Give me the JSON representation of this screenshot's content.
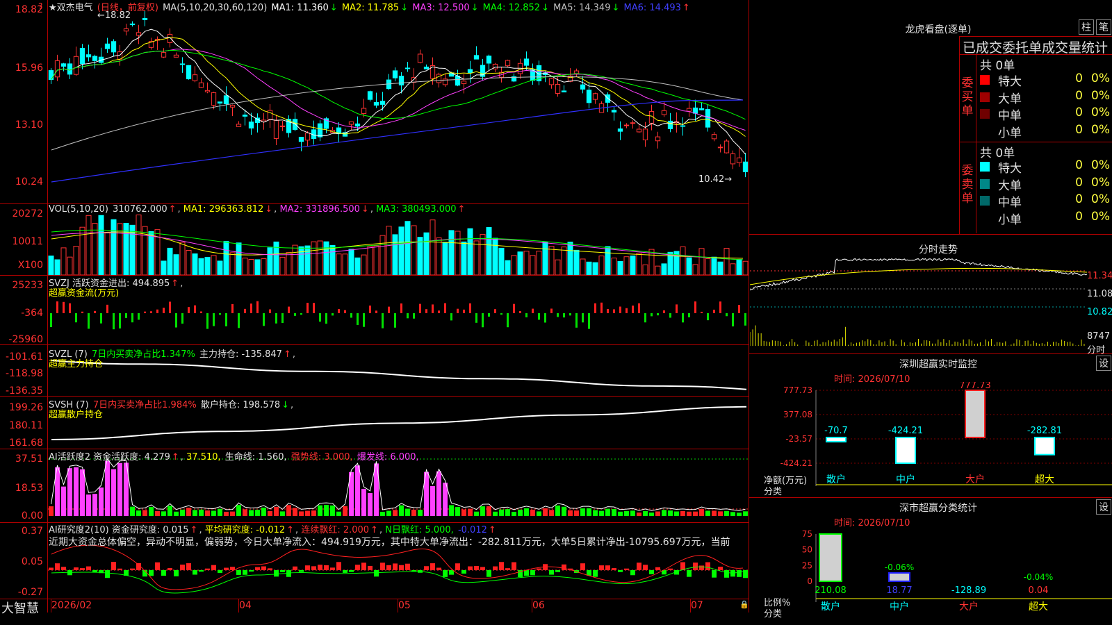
{
  "app": {
    "name": "大智慧"
  },
  "stock": {
    "name": "★双杰电气",
    "period": "(日线，前复权)"
  },
  "ma_legend": {
    "prefix": "MA(5,10,20,30,60,120)",
    "items": [
      {
        "label": "MA1: 11.360",
        "arrow": "↓",
        "color": "#ffffff"
      },
      {
        "label": "MA2: 11.785",
        "arrow": "↓",
        "color": "#ffff00"
      },
      {
        "label": "MA3: 12.500",
        "arrow": "↓",
        "color": "#ff40ff"
      },
      {
        "label": "MA4: 12.852",
        "arrow": "↓",
        "color": "#00ff00"
      },
      {
        "label": "MA5: 14.349",
        "arrow": "↓",
        "color": "#c0c0c0"
      },
      {
        "label": "MA6: 14.493",
        "arrow": "↑",
        "color": "#4040ff"
      }
    ]
  },
  "price_axis": [
    "18.82",
    "15.96",
    "13.10",
    "10.24"
  ],
  "price_marks": {
    "high": "←18.82",
    "low": "10.42→"
  },
  "vol": {
    "axis": [
      "20272",
      "10011",
      "X100"
    ],
    "legend": {
      "prefix": "VOL(5,10,20)",
      "value": "310762.000",
      "ma1": "MA1: 296363.812",
      "ma2": "MA2: 331896.500",
      "ma3": "MA3: 380493.000"
    }
  },
  "svzj": {
    "axis": [
      "25233",
      "-364",
      "-25960"
    ],
    "legend1": "SVZJ  活跃资金进出: 494.895",
    "legend2": "超赢资金流(万元)"
  },
  "svzl": {
    "axis": [
      "-101.61",
      "-118.98",
      "-136.35"
    ],
    "legend_a": "SVZL (7)",
    "legend_b": "7日内买卖净占比1.347%",
    "legend_c": "主力持仓: -135.847",
    "legend2": "超赢主力持仓"
  },
  "svsh": {
    "axis": [
      "199.26",
      "180.11",
      "161.68"
    ],
    "legend_a": "SVSH (7)",
    "legend_b": "7日内买卖净占比1.984%",
    "legend_c": "散户持仓: 198.578",
    "legend2": "超赢散户持仓"
  },
  "ai1": {
    "axis": [
      "37.51",
      "18.53",
      "0.00"
    ],
    "legend": {
      "a": "AI活跃度2 资金活跃度: 4.279",
      "b": "37.510,",
      "c": "生命线: 1.560,",
      "d": "强势线: 3.000,",
      "e": "爆发线: 6.000,"
    }
  },
  "ai2": {
    "axis": [
      "0.37",
      "0.05",
      "-0.27"
    ],
    "legend": {
      "a": "AI研究度2(10) 资金研究度: 0.015",
      "b": "平均研究度: -0.012",
      "c": "连续飘红: 2.000",
      "d": "N日飘红: 5.000,",
      "e": "-0.012"
    },
    "comment": "近期大资金总体偏空，异动不明显，偏弱势，今日大单净流入：494.919万元，其中特大单净流出：-282.811万元，大单5日累计净出-10795.697万元，当前"
  },
  "date_axis": [
    "2026/02",
    "04",
    "05",
    "06",
    "07"
  ],
  "dragon": {
    "title": "龙虎看盘(逐单)",
    "btn_bar": "柱",
    "btn_pen": "笔",
    "subtitle": "已成交委托单成交量统计",
    "buy_label": "委买单",
    "sell_label": "委卖单",
    "buy_total": "共 0单",
    "sell_total": "共 0单",
    "buy_rows": [
      {
        "name": "特大",
        "v1": "0",
        "v2": "0%",
        "color": "#ff0000"
      },
      {
        "name": "大单",
        "v1": "0",
        "v2": "0%",
        "color": "#a00000"
      },
      {
        "name": "中单",
        "v1": "0",
        "v2": "0%",
        "color": "#700000"
      },
      {
        "name": "小单",
        "v1": "0",
        "v2": "0%",
        "color": "#000000"
      }
    ],
    "sell_rows": [
      {
        "name": "特大",
        "v1": "0",
        "v2": "0%",
        "color": "#00ffff"
      },
      {
        "name": "大单",
        "v1": "0",
        "v2": "0%",
        "color": "#008888"
      },
      {
        "name": "中单",
        "v1": "0",
        "v2": "0%",
        "color": "#006868"
      },
      {
        "name": "小单",
        "v1": "0",
        "v2": "0%",
        "color": "#000000"
      }
    ]
  },
  "intraday": {
    "title": "分时走势",
    "p1": "11.34",
    "p2": "11.08",
    "p3": "10.82",
    "vol": "8747",
    "vol_label": "分时"
  },
  "monitor": {
    "title": "深圳超赢实时监控",
    "btn": "设",
    "time": "时间: 2026/07/10",
    "axis": [
      "777.73",
      "377.08",
      "-23.57",
      "-424.21"
    ],
    "values": [
      "-70.7",
      "-424.21",
      "777.73",
      "-282.81"
    ],
    "categories": [
      "散户",
      "中户",
      "大户",
      "超大"
    ],
    "ylabel1": "净额(万元)",
    "ylabel2": "分类"
  },
  "stats": {
    "title": "深市超赢分类统计",
    "btn": "设",
    "time": "时间: 2026/07/10",
    "axis": [
      "75",
      "50",
      "25",
      "0"
    ],
    "pcts": [
      "-0.06%",
      "-0.04%"
    ],
    "values": [
      "210.08",
      "18.77",
      "-128.89",
      "0.04"
    ],
    "categories": [
      "散户",
      "中户",
      "大户",
      "超大"
    ],
    "ylabel1": "比例%",
    "ylabel2": "分类"
  }
}
